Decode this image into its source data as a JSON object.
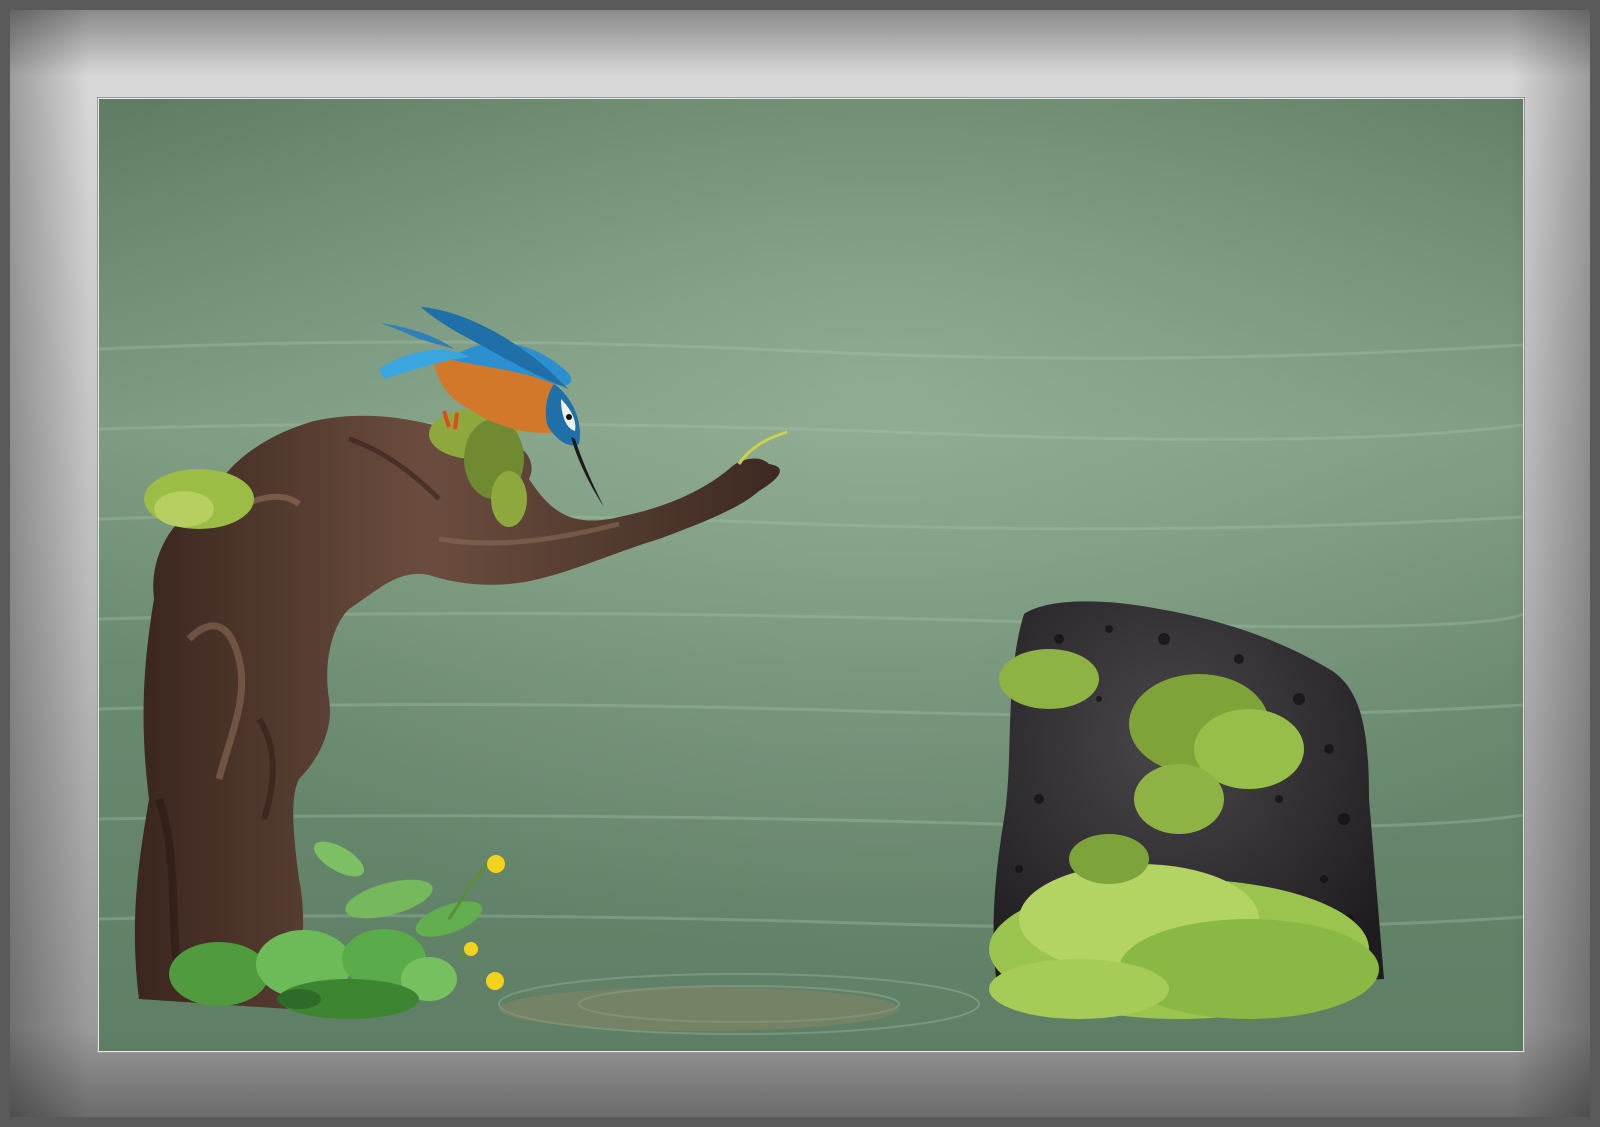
{
  "scene": {
    "subject": "kingfisher-on-driftwood",
    "colors": {
      "water_light": "#7f9e86",
      "water_dark": "#4c6a53",
      "wood": "#4a3329",
      "wood_light": "#8a6a57",
      "rock": "#2e2b2e",
      "moss": "#9bbd45",
      "moss_dark": "#5f7f2c",
      "bird_blue": "#2b8fd0",
      "bird_orange": "#d2782a",
      "flower_yellow": "#f2d21b",
      "leaf_green": "#5da84a"
    }
  }
}
